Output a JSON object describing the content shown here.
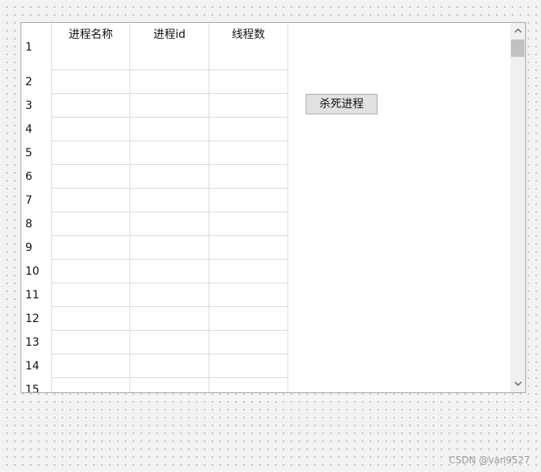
{
  "table": {
    "columns": [
      "进程名称",
      "进程id",
      "线程数"
    ],
    "rows": [
      "1",
      "2",
      "3",
      "4",
      "5",
      "6",
      "7",
      "8",
      "9",
      "10",
      "11",
      "12",
      "13",
      "14",
      "15"
    ]
  },
  "actions": {
    "kill_label": "杀死进程"
  },
  "icons": {
    "scroll_up": "chevron-up-icon",
    "scroll_down": "chevron-down-icon"
  },
  "watermark": "CSDN @van9527"
}
